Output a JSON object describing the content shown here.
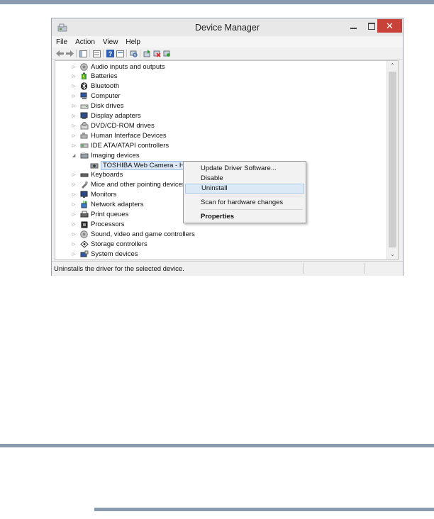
{
  "window": {
    "title": "Device Manager",
    "controls": {
      "minimize": "",
      "maximize": "",
      "close": "✕"
    }
  },
  "menubar": {
    "items": [
      "File",
      "Action",
      "View",
      "Help"
    ]
  },
  "toolbar": {
    "icons": [
      "back-arrow-icon",
      "forward-arrow-icon",
      "show-hide-tree-icon",
      "properties-icon",
      "help-icon",
      "view-icon",
      "scan-hardware-icon",
      "update-driver-icon",
      "disable-device-icon",
      "uninstall-device-icon"
    ]
  },
  "tree": {
    "items": [
      {
        "label": "Audio inputs and outputs",
        "expanded": false,
        "icon": "speaker-icon"
      },
      {
        "label": "Batteries",
        "expanded": false,
        "icon": "battery-icon"
      },
      {
        "label": "Bluetooth",
        "expanded": false,
        "icon": "bluetooth-icon"
      },
      {
        "label": "Computer",
        "expanded": false,
        "icon": "computer-icon"
      },
      {
        "label": "Disk drives",
        "expanded": false,
        "icon": "disk-drive-icon"
      },
      {
        "label": "Display adapters",
        "expanded": false,
        "icon": "display-adapter-icon"
      },
      {
        "label": "DVD/CD-ROM drives",
        "expanded": false,
        "icon": "dvd-drive-icon"
      },
      {
        "label": "Human Interface Devices",
        "expanded": false,
        "icon": "hid-icon"
      },
      {
        "label": "IDE ATA/ATAPI controllers",
        "expanded": false,
        "icon": "ide-controller-icon"
      },
      {
        "label": "Imaging devices",
        "expanded": true,
        "icon": "imaging-device-icon"
      },
      {
        "label": "TOSHIBA Web Camera - HD",
        "child": true,
        "selected": true,
        "icon": "web-camera-icon"
      },
      {
        "label": "Keyboards",
        "expanded": false,
        "icon": "keyboard-icon"
      },
      {
        "label": "Mice and other pointing devices",
        "expanded": false,
        "icon": "mouse-icon"
      },
      {
        "label": "Monitors",
        "expanded": false,
        "icon": "monitor-icon"
      },
      {
        "label": "Network adapters",
        "expanded": false,
        "icon": "network-adapter-icon"
      },
      {
        "label": "Print queues",
        "expanded": false,
        "icon": "printer-icon"
      },
      {
        "label": "Processors",
        "expanded": false,
        "icon": "processor-icon"
      },
      {
        "label": "Sound, video and game controllers",
        "expanded": false,
        "icon": "sound-controller-icon"
      },
      {
        "label": "Storage controllers",
        "expanded": false,
        "icon": "storage-controller-icon"
      },
      {
        "label": "System devices",
        "expanded": false,
        "icon": "system-device-icon"
      }
    ]
  },
  "context_menu": {
    "items": [
      "Update Driver Software...",
      "Disable",
      "Uninstall",
      "Scan for hardware changes",
      "Properties"
    ],
    "highlighted": "Uninstall"
  },
  "statusbar": {
    "text": "Uninstalls the driver for the selected device."
  },
  "colors": {
    "page_rule": "#8a9bb0",
    "close_button": "#c9423a",
    "selection": "#dbe8f7",
    "context_highlight": "#dbe9f7"
  }
}
